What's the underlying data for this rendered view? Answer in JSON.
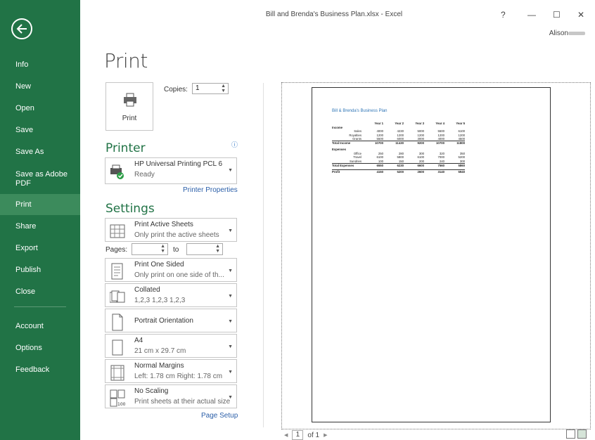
{
  "window": {
    "title": "Bill and Brenda's Business Plan.xlsx - Excel",
    "help": "?",
    "minimize": "—",
    "maximize": "☐",
    "close": "✕",
    "account": "Alison"
  },
  "sidebar": {
    "items": [
      "Info",
      "New",
      "Open",
      "Save",
      "Save As",
      "Save as Adobe PDF",
      "Print",
      "Share",
      "Export",
      "Publish",
      "Close",
      "Account",
      "Options",
      "Feedback"
    ],
    "active": "Print"
  },
  "print": {
    "title": "Print",
    "button_label": "Print",
    "copies_label": "Copies:",
    "copies_value": "1",
    "printer_heading": "Printer",
    "printer_name": "HP Universal Printing PCL 6",
    "printer_status": "Ready",
    "printer_properties": "Printer Properties",
    "settings_heading": "Settings",
    "pages_label": "Pages:",
    "pages_to": "to",
    "page_setup": "Page Setup",
    "settings": [
      {
        "l1": "Print Active Sheets",
        "l2": "Only print the active sheets"
      },
      {
        "l1": "Print One Sided",
        "l2": "Only print on one side of th..."
      },
      {
        "l1": "Collated",
        "l2": "1,2,3   1,2,3   1,2,3"
      },
      {
        "l1": "Portrait Orientation",
        "l2": ""
      },
      {
        "l1": "A4",
        "l2": "21 cm x 29.7 cm"
      },
      {
        "l1": "Normal Margins",
        "l2": "Left:  1.78 cm   Right:  1.78 cm"
      },
      {
        "l1": "No Scaling",
        "l2": "Print sheets at their actual size"
      }
    ]
  },
  "preview": {
    "sheet_title": "Bill & Brenda's Business Plan",
    "header": [
      "",
      "Year 1",
      "Year 2",
      "Year 3",
      "Year 4",
      "Year 5"
    ],
    "rows": [
      [
        "Income",
        "",
        "",
        "",
        "",
        ""
      ],
      [
        "Sales",
        "4000",
        "4230",
        "5000",
        "5500",
        "6100"
      ],
      [
        "Royalties",
        "1200",
        "1200",
        "1200",
        "1200",
        "1200"
      ],
      [
        "Grants",
        "5500",
        "6000",
        "3000",
        "4000",
        "4500"
      ],
      [
        "Total Income",
        "10700",
        "11430",
        "9200",
        "10700",
        "11800"
      ],
      [
        "",
        "",
        "",
        "",
        "",
        ""
      ],
      [
        "Expenses",
        "",
        "",
        "",
        "",
        ""
      ],
      [
        "Office",
        "250",
        "280",
        "300",
        "320",
        "350"
      ],
      [
        "Travel",
        "6100",
        "5800",
        "6100",
        "7000",
        "5200"
      ],
      [
        "Sundries",
        "100",
        "150",
        "200",
        "240",
        "300"
      ],
      [
        "Total Expenses",
        "6550",
        "6230",
        "6600",
        "7560",
        "5860"
      ],
      [
        "",
        "",
        "",
        "",
        "",
        ""
      ],
      [
        "Profit",
        "4150",
        "5200",
        "2600",
        "3140",
        "5940"
      ]
    ],
    "page_current": "1",
    "page_of": "of 1"
  }
}
